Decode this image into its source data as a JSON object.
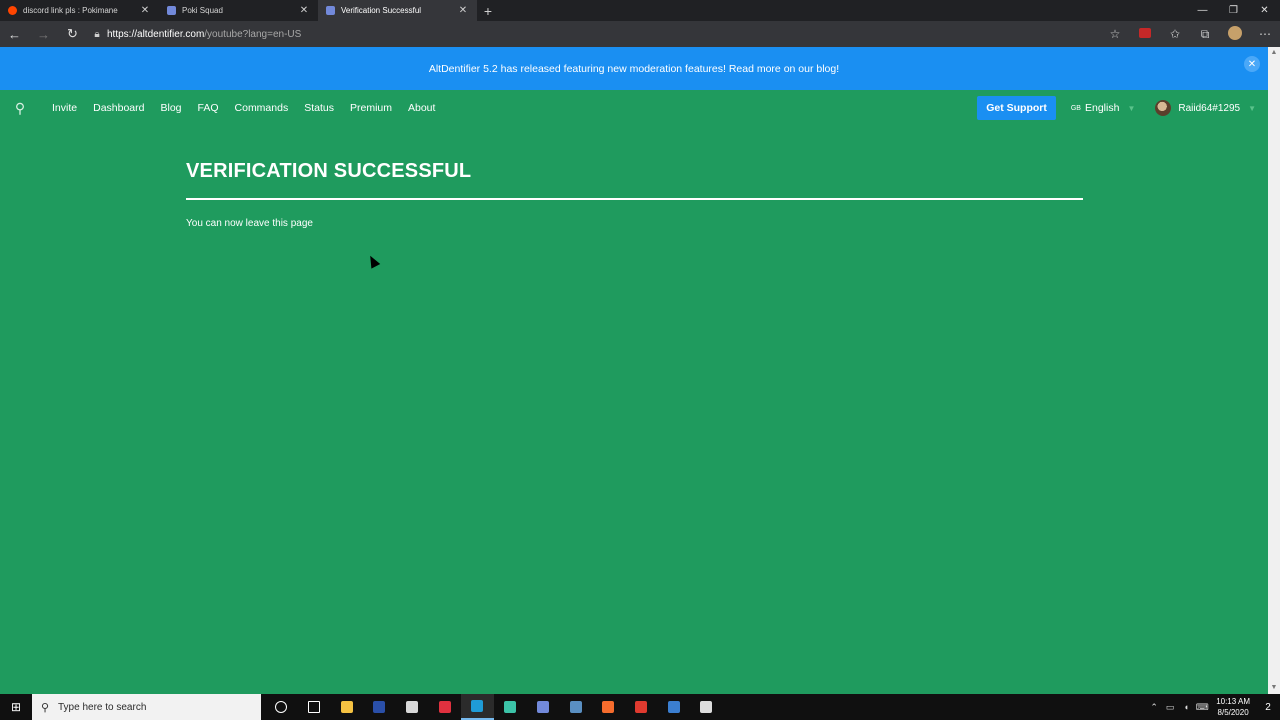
{
  "browser": {
    "tabs": [
      {
        "title": "discord link pls : Pokimane",
        "favicon_color": "#ff4500",
        "active": false
      },
      {
        "title": "Poki Squad",
        "favicon_color": "#7289da",
        "active": false
      },
      {
        "title": "Verification Successful",
        "favicon_color": "#7289da",
        "active": true
      }
    ],
    "new_tab": "+",
    "close_glyph": "✕",
    "window": {
      "minimize": "—",
      "restore": "❐",
      "close": "✕"
    },
    "address": {
      "host": "https://altdentifier.com",
      "path": "/youtube?lang=en-US"
    }
  },
  "banner": {
    "text": "AltDentifier 5.2 has released featuring new moderation features! Read more on our blog!",
    "close": "✕"
  },
  "nav": {
    "links": [
      "Invite",
      "Dashboard",
      "Blog",
      "FAQ",
      "Commands",
      "Status",
      "Premium",
      "About"
    ],
    "support": "Get Support",
    "lang_flag": "GB",
    "language": "English",
    "username": "Raiid64#1295"
  },
  "main": {
    "title": "VERIFICATION SUCCESSFUL",
    "message": "You can now leave this page"
  },
  "taskbar": {
    "search_placeholder": "Type here to search",
    "apps": [
      {
        "name": "cortana",
        "color": "#ffffff"
      },
      {
        "name": "task-view",
        "color": "#ffffff"
      },
      {
        "name": "file-explorer",
        "color": "#f5c242"
      },
      {
        "name": "photoshop",
        "color": "#2a4fa8"
      },
      {
        "name": "obs",
        "color": "#d9d9d9"
      },
      {
        "name": "valorant",
        "color": "#e0313f"
      },
      {
        "name": "edge",
        "color": "#1f9bd6"
      },
      {
        "name": "discord-like",
        "color": "#3cc3a8"
      },
      {
        "name": "game-launcher",
        "color": "#7289da"
      },
      {
        "name": "steam",
        "color": "#5a8fc2"
      },
      {
        "name": "origin",
        "color": "#f56c2d"
      },
      {
        "name": "roblox",
        "color": "#e03a2f"
      },
      {
        "name": "vs",
        "color": "#3b7fd1"
      },
      {
        "name": "terminal",
        "color": "#dddddd"
      }
    ],
    "time": "10:13 AM",
    "date": "8/5/2020",
    "notifications": "2"
  }
}
